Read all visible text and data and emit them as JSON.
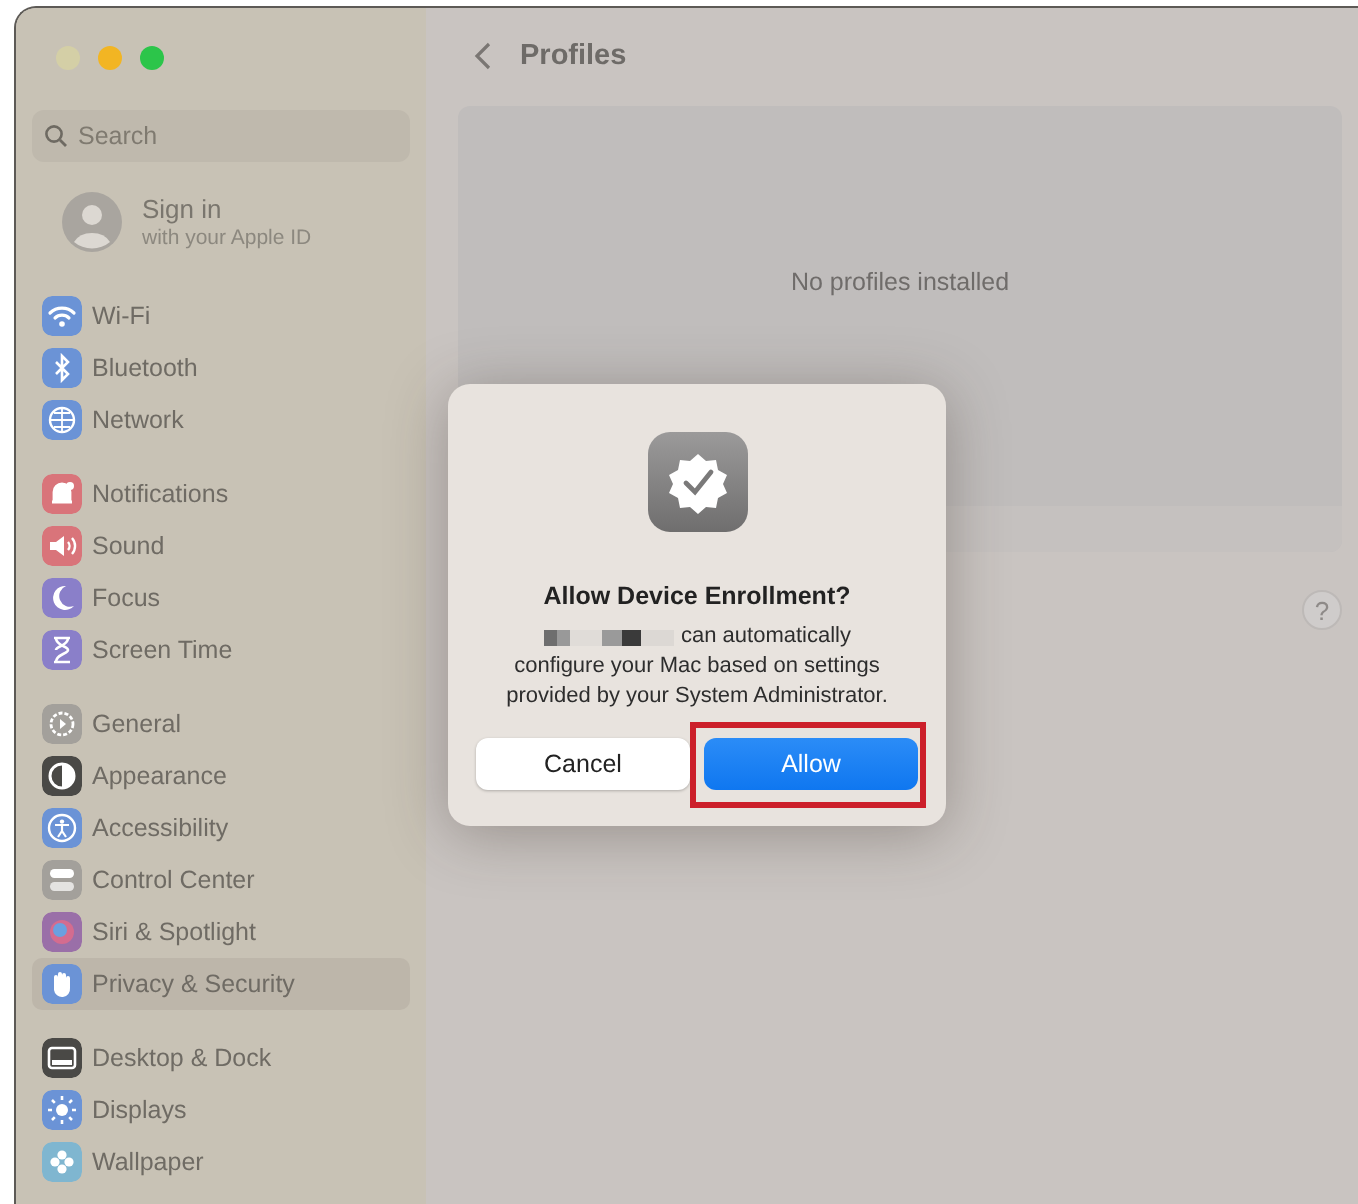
{
  "window": {
    "traffic_lights": [
      {
        "color": "#d4cfa6"
      },
      {
        "color": "#f2b523"
      },
      {
        "color": "#2cc54a"
      }
    ]
  },
  "sidebar": {
    "search": {
      "placeholder": "Search"
    },
    "account": {
      "title": "Sign in",
      "subtitle": "with your Apple ID"
    },
    "groups": [
      {
        "items": [
          {
            "label": "Wi-Fi",
            "kind": "wifi",
            "color": "#6b93d6",
            "selected": false
          },
          {
            "label": "Bluetooth",
            "kind": "bluetooth",
            "color": "#6b93d6",
            "selected": false
          },
          {
            "label": "Network",
            "kind": "globe",
            "color": "#6b93d6",
            "selected": false
          }
        ]
      },
      {
        "items": [
          {
            "label": "Notifications",
            "kind": "bell",
            "color": "#d9747a",
            "selected": false
          },
          {
            "label": "Sound",
            "kind": "speaker",
            "color": "#d9747a",
            "selected": false
          },
          {
            "label": "Focus",
            "kind": "moon",
            "color": "#8a7fc9",
            "selected": false
          },
          {
            "label": "Screen Time",
            "kind": "hourglass",
            "color": "#8a7fc9",
            "selected": false
          }
        ]
      },
      {
        "items": [
          {
            "label": "General",
            "kind": "gear",
            "color": "#a3a09b",
            "selected": false
          },
          {
            "label": "Appearance",
            "kind": "contrast",
            "color": "#4a4946",
            "selected": false
          },
          {
            "label": "Accessibility",
            "kind": "person",
            "color": "#6b93d6",
            "selected": false
          },
          {
            "label": "Control Center",
            "kind": "toggles",
            "color": "#a3a09b",
            "selected": false
          },
          {
            "label": "Siri & Spotlight",
            "kind": "orb",
            "color": "#9a6fa8",
            "selected": false
          },
          {
            "label": "Privacy & Security",
            "kind": "hand",
            "color": "#6b93d6",
            "selected": true
          }
        ]
      },
      {
        "items": [
          {
            "label": "Desktop & Dock",
            "kind": "dock",
            "color": "#4a4946",
            "selected": false
          },
          {
            "label": "Displays",
            "kind": "sun",
            "color": "#6b93d6",
            "selected": false
          },
          {
            "label": "Wallpaper",
            "kind": "flower",
            "color": "#7fb6d0",
            "selected": false
          }
        ]
      }
    ]
  },
  "main": {
    "title": "Profiles",
    "empty_message": "No profiles installed",
    "help": "?"
  },
  "dialog": {
    "title": "Allow Device Enrollment?",
    "message_lines": [
      "can automatically",
      "configure your Mac based on settings",
      "provided by your System Administrator."
    ],
    "buttons": [
      {
        "label": "Cancel",
        "kind": "secondary",
        "highlighted": false
      },
      {
        "label": "Allow",
        "kind": "primary",
        "highlighted": true
      }
    ]
  }
}
